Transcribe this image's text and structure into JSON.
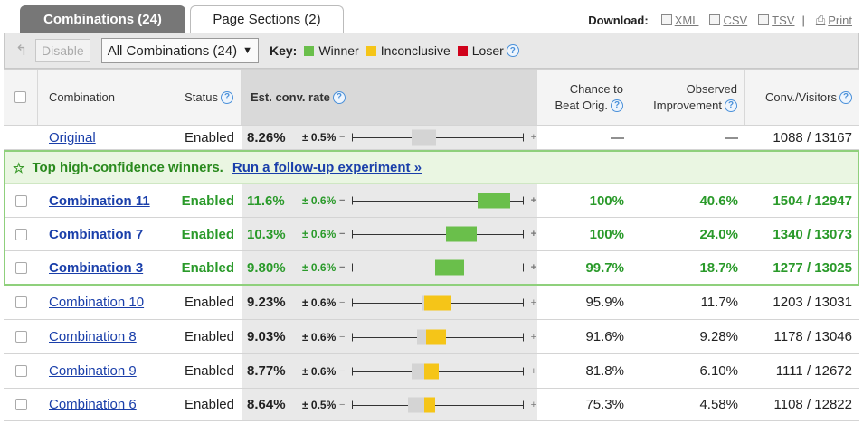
{
  "tabs": {
    "active": "Combinations (24)",
    "inactive": "Page Sections (2)"
  },
  "download": {
    "label": "Download:",
    "xml": "XML",
    "csv": "CSV",
    "tsv": "TSV",
    "separator": "|",
    "print": "Print"
  },
  "toolbar": {
    "disable_label": "Disable",
    "filter_value": "All Combinations (24)",
    "key_label": "Key:",
    "legend": [
      {
        "label": "Winner",
        "color": "#6abf4b"
      },
      {
        "label": "Inconclusive",
        "color": "#f5c518"
      },
      {
        "label": "Loser",
        "color": "#d0021b"
      }
    ]
  },
  "headers": {
    "combination": "Combination",
    "status": "Status",
    "est_rate": "Est. conv. rate",
    "chance_line1": "Chance to",
    "chance_line2": "Beat Orig.",
    "impr_line1": "Observed",
    "impr_line2": "Improvement",
    "conv": "Conv./Visitors"
  },
  "original": {
    "name": "Original",
    "status": "Enabled",
    "rate": "8.26%",
    "pm": "± 0.5%",
    "chance": "—",
    "improvement": "—",
    "conv": "1088 / 13167"
  },
  "banner": {
    "text": "Top high-confidence winners.",
    "link": "Run a follow-up experiment »"
  },
  "rows": [
    {
      "name": "Combination 11",
      "status": "Enabled",
      "rate": "11.6%",
      "pm": "± 0.6%",
      "chance": "100%",
      "improvement": "40.6%",
      "conv": "1504 / 12947"
    },
    {
      "name": "Combination 7",
      "status": "Enabled",
      "rate": "10.3%",
      "pm": "± 0.6%",
      "chance": "100%",
      "improvement": "24.0%",
      "conv": "1340 / 13073"
    },
    {
      "name": "Combination 3",
      "status": "Enabled",
      "rate": "9.80%",
      "pm": "± 0.6%",
      "chance": "99.7%",
      "improvement": "18.7%",
      "conv": "1277 / 13025"
    },
    {
      "name": "Combination 10",
      "status": "Enabled",
      "rate": "9.23%",
      "pm": "± 0.6%",
      "chance": "95.9%",
      "improvement": "11.7%",
      "conv": "1203 / 13031"
    },
    {
      "name": "Combination 8",
      "status": "Enabled",
      "rate": "9.03%",
      "pm": "± 0.6%",
      "chance": "91.6%",
      "improvement": "9.28%",
      "conv": "1178 / 13046"
    },
    {
      "name": "Combination 9",
      "status": "Enabled",
      "rate": "8.77%",
      "pm": "± 0.6%",
      "chance": "81.8%",
      "improvement": "6.10%",
      "conv": "1111 / 12672"
    },
    {
      "name": "Combination 6",
      "status": "Enabled",
      "rate": "8.64%",
      "pm": "± 0.5%",
      "chance": "75.3%",
      "improvement": "4.58%",
      "conv": "1108 / 12822"
    }
  ]
}
